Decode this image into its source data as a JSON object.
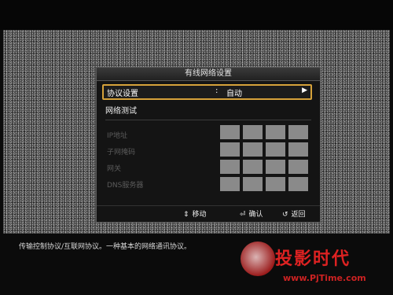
{
  "menu": {
    "title": "有线网络设置",
    "protocol_setting": {
      "label": "协议设置",
      "colon": ":",
      "value": "自动",
      "arrow": "▶"
    },
    "network_test": "网络测试",
    "fields": [
      {
        "label": "IP地址"
      },
      {
        "label": "子网掩码"
      },
      {
        "label": "网关"
      },
      {
        "label": "DNS服务器"
      }
    ],
    "footer": {
      "move_icon": "⇕",
      "move_label": "移动",
      "confirm_icon": "⏎",
      "confirm_label": "确认",
      "back_icon": "↺",
      "back_label": "返回"
    }
  },
  "description": "传输控制协议/互联网协议。一种基本的网络通讯协议。",
  "watermark": {
    "title": "投影时代",
    "url": "www.PjTime.com"
  },
  "colors": {
    "highlight": "#d6a23a",
    "menu_bg": "#141414",
    "field_box": "#8a8a8a"
  }
}
